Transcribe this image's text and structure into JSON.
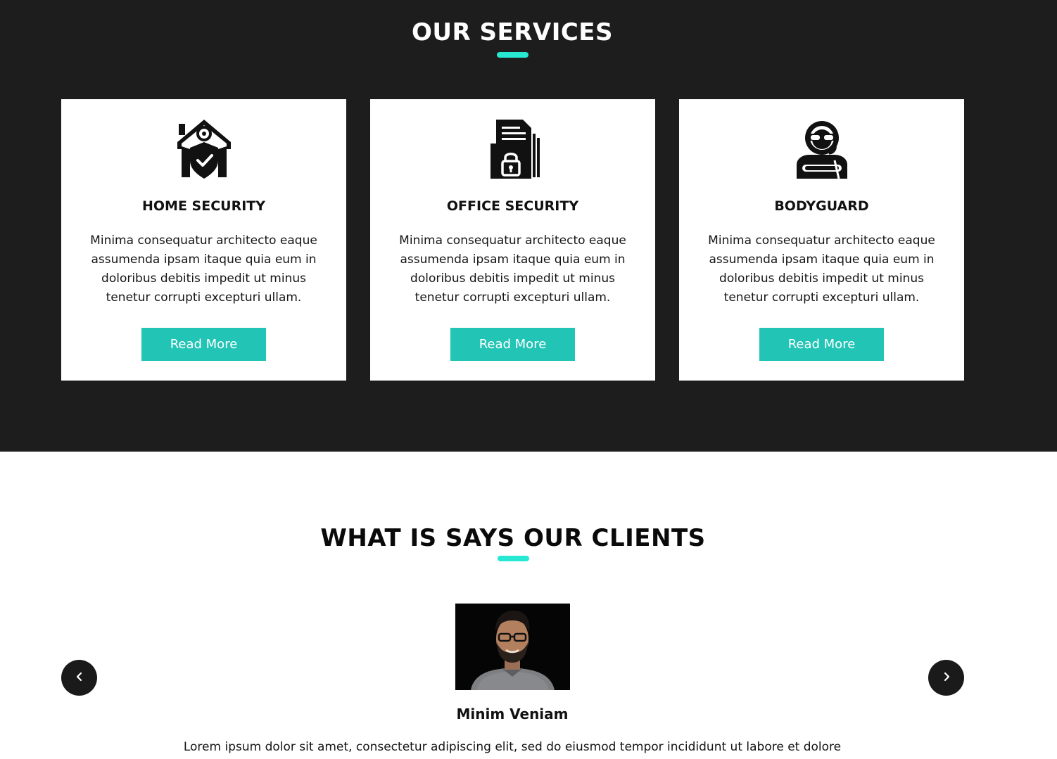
{
  "colors": {
    "dark_bg": "#1d1d1d",
    "accent": "#27e8d2",
    "button": "#22c4b5",
    "card_bg": "#ffffff"
  },
  "services": {
    "title": "OUR SERVICES",
    "cards": [
      {
        "icon": "home-shield-icon",
        "title": "HOME SECURITY",
        "text": "Minima consequatur architecto eaque assumenda ipsam itaque quia eum in doloribus debitis impedit ut minus tenetur corrupti excepturi ullam.",
        "button": "Read More"
      },
      {
        "icon": "locked-folder-icon",
        "title": "OFFICE SECURITY",
        "text": "Minima consequatur architecto eaque assumenda ipsam itaque quia eum in doloribus debitis impedit ut minus tenetur corrupti excepturi ullam.",
        "button": "Read More"
      },
      {
        "icon": "bodyguard-icon",
        "title": "BODYGUARD",
        "text": "Minima consequatur architecto eaque assumenda ipsam itaque quia eum in doloribus debitis impedit ut minus tenetur corrupti excepturi ullam.",
        "button": "Read More"
      }
    ]
  },
  "clients": {
    "title": "WHAT IS SAYS OUR CLIENTS",
    "testimonial": {
      "name": "Minim Veniam",
      "quote": "Lorem ipsum dolor sit amet, consectetur adipiscing elit, sed do eiusmod tempor incididunt ut labore et dolore"
    },
    "prev_icon": "chevron-left-icon",
    "next_icon": "chevron-right-icon"
  }
}
